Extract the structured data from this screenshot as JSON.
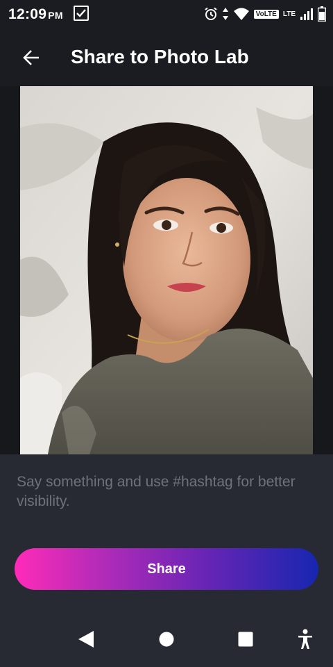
{
  "status_bar": {
    "time": "12:09",
    "ampm": "PM",
    "volte": "VoLTE",
    "lte": "LTE",
    "icons": [
      "checkbox-notification-icon",
      "alarm-icon",
      "data-arrows-icon",
      "wifi-icon",
      "signal-icon",
      "battery-icon"
    ]
  },
  "app_bar": {
    "back_icon": "arrow-left-icon",
    "title": "Share to Photo Lab"
  },
  "photo": {
    "description_icon": "portrait-photo"
  },
  "caption": {
    "value": "",
    "placeholder": "Say something and use #hashtag for better visibility."
  },
  "share_button": {
    "label": "Share",
    "gradient_start": "#ff2bb8",
    "gradient_end": "#1726b0"
  },
  "nav_bar": {
    "items": [
      "back-triangle-icon",
      "home-circle-icon",
      "recents-square-icon",
      "accessibility-icon"
    ]
  }
}
